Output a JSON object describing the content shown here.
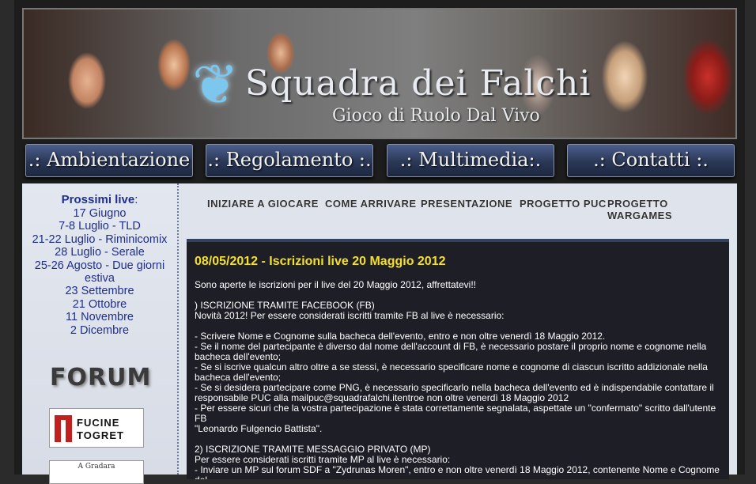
{
  "banner": {
    "title": "Squadra dei Falchi",
    "subtitle": "Gioco di Ruolo Dal Vivo"
  },
  "main_nav": [
    {
      "label": ".: Ambientazione :."
    },
    {
      "label": ".: Regolamento :."
    },
    {
      "label": ".: Multimedia:."
    },
    {
      "label": ".: Contatti :."
    }
  ],
  "sub_nav": [
    {
      "label": "INIZIARE A GIOCARE"
    },
    {
      "label": "COME ARRIVARE"
    },
    {
      "label": "PRESENTAZIONE"
    },
    {
      "label": "PROGETTO PUC"
    },
    {
      "label": "PROGETTO WARGAMES"
    }
  ],
  "sidebar": {
    "live_title": "Prossimi live",
    "live_colon": ":",
    "live_items": [
      "17 Giugno",
      "7-8 Luglio - TLD",
      "21-22 Luglio - Riminicomix",
      "28 Luglio - Serale",
      "25-26 Agosto - Due giorni",
      "estiva",
      "23 Settembre",
      "21 Ottobre",
      "11 Novembre",
      "2 Dicembre"
    ],
    "forum_label": "FORUM",
    "sponsor1_line1": "FUCINE",
    "sponsor1_line2": "TOGRET",
    "sponsor2_text": "A Gradara"
  },
  "news": {
    "title": "08/05/2012 - Iscrizioni live 20 Maggio 2012",
    "intro": "Sono aperte le iscrizioni per il live del 20 Maggio 2012, affrettatevi!!",
    "fb_heading": ") ISCRIZIONE TRAMITE FACEBOOK (FB)",
    "fb_sub": "Novità 2012! Per essere considerati iscritti tramite FB al live è necessario:",
    "fb_items": [
      "- Scrivere Nome e Cognome sulla bacheca dell'evento, entro e non oltre venerdì 18 Maggio 2012.",
      "- Se il nome del partecipante è diverso dal nome dell'account di FB, è necessario postare il proprio nome e cognome nella",
      "bacheca dell'evento;",
      "- Se si iscrive qualcun altro oltre a se stessi, è necessario specificare nome e cognome di ciascun iscritto addizionale nella",
      "bacheca dell'evento;",
      "- Se si desidera partecipare come PNG, è necessario specificarlo nella bacheca dell'evento ed è indispendabile contattare il",
      "responsabile PUC alla mailpuc@squadrafalchi.itentroe non oltre venerdì 18 Maggio 2012",
      "- Per essere sicuri che la vostra partecipazione è stata correttamente segnalata, aspettate un \"confermato\" scritto dall'utente FB",
      "\"Leonardo Fulgencio Battista\"."
    ],
    "mp_heading": "2) ISCRIZIONE TRAMITE MESSAGGIO PRIVATO (MP)",
    "mp_sub": "Per essere considerati iscritti tramite MP al live è necessario:",
    "mp_items": [
      "- Inviare un MP sul forum SDF a \"Zydrunas Moren\", entro e non oltre venerdì 18 Maggio 2012, contenente Nome e Cognome del"
    ]
  }
}
